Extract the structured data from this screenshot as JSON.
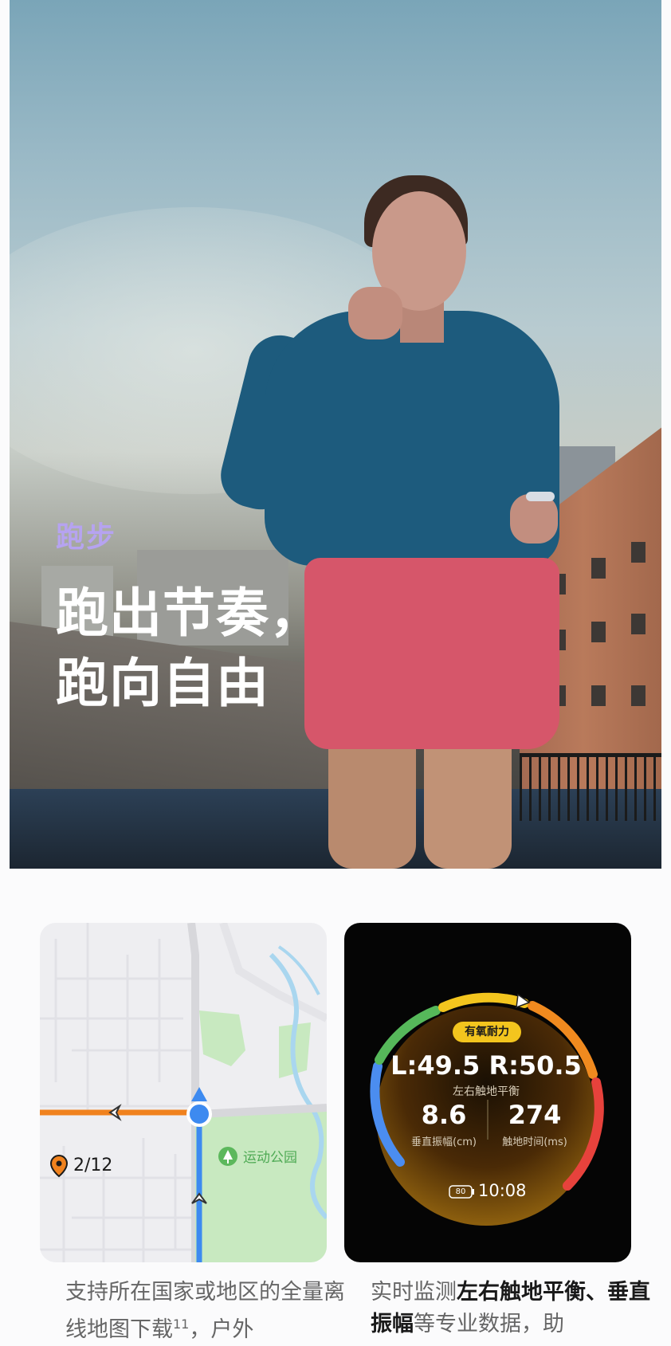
{
  "hero": {
    "category": "跑步",
    "title_lines": [
      "跑出节奏，",
      "跑向自由"
    ]
  },
  "map_card": {
    "park_label": "运动公园",
    "waypoint": "2/12",
    "colors": {
      "route": "#f0821e",
      "track": "#3d8af0",
      "park": "#c8e9c0",
      "water": "#a9d6ef"
    },
    "icons": [
      "location-pin-icon",
      "tree-icon",
      "direction-arrow-icon",
      "chevron-left-icon",
      "chevron-up-icon"
    ]
  },
  "watch_card": {
    "zone_badge": "有氧耐力",
    "balance_value": "L:49.5 R:50.5",
    "balance_label": "左右触地平衡",
    "vertical_value": "8.6",
    "vertical_label": "垂直振幅(cm)",
    "contact_value": "274",
    "contact_label": "触地时间(ms)",
    "battery": "80",
    "time": "10:08",
    "zone_colors": [
      "#4b8df0",
      "#56b85a",
      "#f3c51e",
      "#f08a1f",
      "#e7423c"
    ]
  },
  "captions": {
    "map": {
      "text": "支持所在国家或地区的全量离线地图下载",
      "footnote": "11",
      "text_tail": "，户外"
    },
    "watch": {
      "prefix": "实时监测",
      "bold_1": "左右触地平衡、",
      "bold_2": "垂直振幅",
      "suffix": "等专业数据，助"
    }
  }
}
